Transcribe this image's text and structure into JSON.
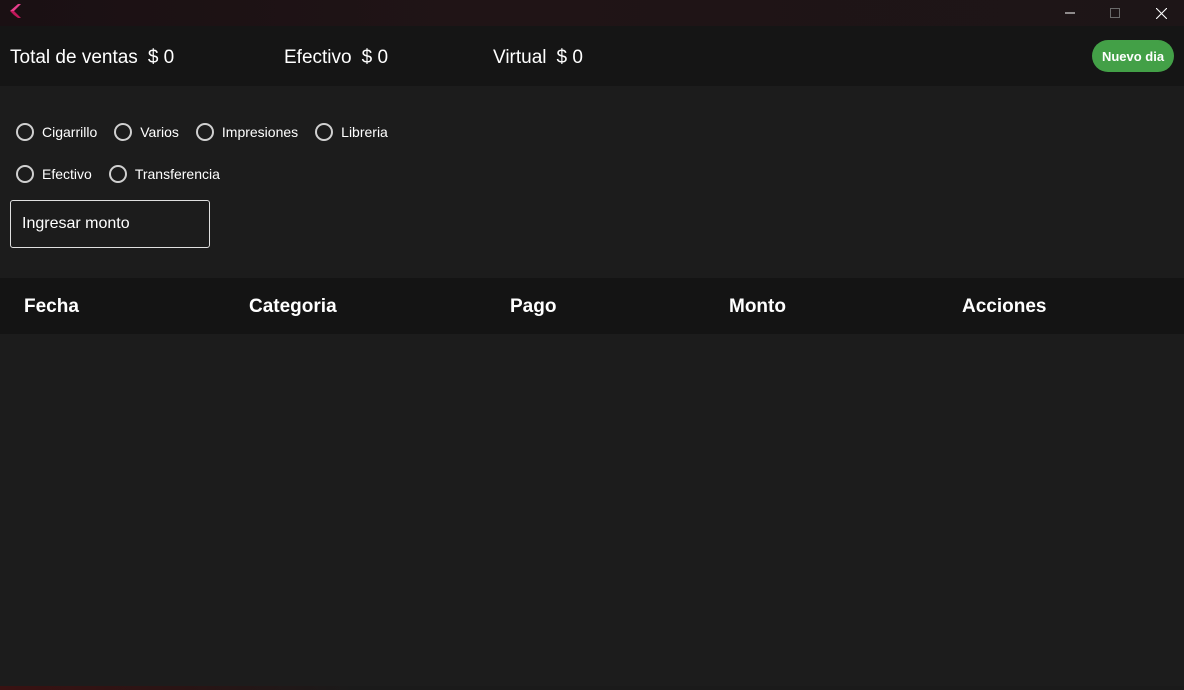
{
  "window": {
    "logo_icon": "flutter-logo-icon",
    "controls": {
      "minimize_icon": "minimize-icon",
      "maximize_icon": "maximize-icon",
      "close_icon": "close-icon"
    }
  },
  "totals": {
    "sales_label": "Total de ventas",
    "sales_value": "$ 0",
    "cash_label": "Efectivo",
    "cash_value": "$ 0",
    "virtual_label": "Virtual",
    "virtual_value": "$ 0",
    "new_day_button": "Nuevo dia",
    "new_day_color": "#43a047"
  },
  "form": {
    "categories": [
      {
        "label": "Cigarrillo",
        "selected": false
      },
      {
        "label": "Varios",
        "selected": false
      },
      {
        "label": "Impresiones",
        "selected": false
      },
      {
        "label": "Libreria",
        "selected": false
      }
    ],
    "payments": [
      {
        "label": "Efectivo",
        "selected": false
      },
      {
        "label": "Transferencia",
        "selected": false
      }
    ],
    "amount_placeholder": "Ingresar monto",
    "amount_value": ""
  },
  "table": {
    "columns": [
      "Fecha",
      "Categoria",
      "Pago",
      "Monto",
      "Acciones"
    ],
    "rows": []
  }
}
